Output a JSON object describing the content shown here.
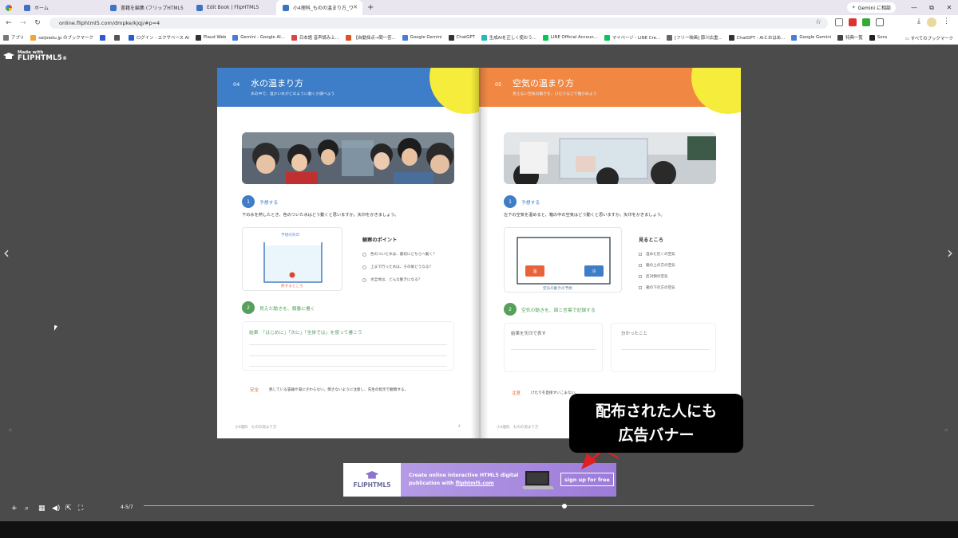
{
  "browser": {
    "tabs": [
      {
        "label": "ホーム"
      },
      {
        "label": "書籍を編集 (フリップHTML5"
      },
      {
        "label": "Edit Book | FlipHTML5"
      },
      {
        "label": "小4理科_ものの温まり方_ワ"
      }
    ],
    "new_tab": "+",
    "gemini_label": "Gemini に相談",
    "window_controls": [
      "—",
      "⧉",
      "✕"
    ],
    "url": "online.fliphtml5.com/dmpke/kjqj/#p=4",
    "bookmarks": [
      {
        "label": "アプリ"
      },
      {
        "label": "saijoedu.jp のブックマーク"
      },
      {
        "label": ""
      },
      {
        "label": ""
      },
      {
        "label": "ログイン - エクサベース AI"
      },
      {
        "label": "Plaud Web"
      },
      {
        "label": "Gemini - Google AI..."
      },
      {
        "label": "日本語 音声読み上..."
      },
      {
        "label": "【自動採点→問一答..."
      },
      {
        "label": "Google Gemini"
      },
      {
        "label": "ChatGPT"
      },
      {
        "label": "生成AIを正しく使おう..."
      },
      {
        "label": "LINE Official Accoun..."
      },
      {
        "label": "マイページ - LINE Cre..."
      },
      {
        "label": "[フリー映画] 節川広重..."
      },
      {
        "label": "ChatGPT - AIとおはあ..."
      },
      {
        "label": "Google Gemini"
      },
      {
        "label": "特典一覧"
      },
      {
        "label": "Sora"
      }
    ],
    "all_bookmarks": "すべてのブックマーク"
  },
  "viewer": {
    "logo_small": "Made with",
    "logo_big": "FLIPHTML5",
    "logo_reg": "®",
    "prev_arrow": "‹",
    "next_arrow": "›",
    "dim_prev": "«",
    "dim_next": "»",
    "page_indicator": "4-5/7",
    "progress": 0.627,
    "toolbar_icons": [
      "zoom-in-icon",
      "search-icon",
      "grid-icon",
      "sound-icon",
      "share-icon",
      "fullscreen-icon"
    ]
  },
  "left_page": {
    "num": "04",
    "title": "水の温まり方",
    "subtitle": "水の中で、温かい水がどのように動くか調べよう",
    "step1_num": "1",
    "step1_label": "予想する",
    "step1_question": "下の水を熱したとき、色のついた水はどう動くと思いますか。矢印をかきましょう。",
    "diagram_title": "予想の矢印",
    "diagram_caption": "熱するところ",
    "points_title": "観察のポイント",
    "points": [
      "色のついた水は、最初にどちらへ動く？",
      "上まで行った水は、その後どうなる？",
      "水全体は、どんな動きになる？"
    ],
    "step2_num": "2",
    "step2_label": "見えた動きを、順番に書く",
    "write_hint": "結果　「はじめに」「次に」「全体では」を使って書こう",
    "safety_label": "安全",
    "safety_text": "熱している容器や湯にさわらない。倒さないように注意し、先生の指示で観察する。",
    "footer_left": "小4理科　ものの温まり方",
    "footer_num": "4"
  },
  "right_page": {
    "num": "05",
    "title": "空気の温まり方",
    "subtitle": "見えない空気の動きを、けむりなどで確かめよう",
    "step1_num": "1",
    "step1_label": "予想する",
    "step1_question": "左下の空気を温めると、箱の中の空気はどう動くと思いますか。矢印をかきましょう。",
    "heater_label": "温",
    "ice_label": "冷",
    "diagram_caption": "空気の動きの予想",
    "points_title": "見るところ",
    "points": [
      "温めた近くの空気",
      "箱の上の方の空気",
      "反対側の空気",
      "箱の下の方の空気"
    ],
    "step2_num": "2",
    "step2_label": "空気の動きを、図と言葉で記録する",
    "result_label": "結果を矢印で表す",
    "found_label": "分かったこと",
    "note_label": "注意",
    "note_text": "けむりを直接すいこまない。",
    "footer_left": "小4理科　ものの温まり方",
    "footer_num": "5"
  },
  "ad_banner": {
    "logo": "FLIPHTML5",
    "line1": "Create online interactive HTML5 digital",
    "line2_prefix": "publication with ",
    "line2_link": "fliphtml5.com",
    "cta": "sign up for free"
  },
  "annotation": {
    "line1": "配布された人にも",
    "line2": "広告バナー",
    "arrow_color": "#e02020"
  }
}
